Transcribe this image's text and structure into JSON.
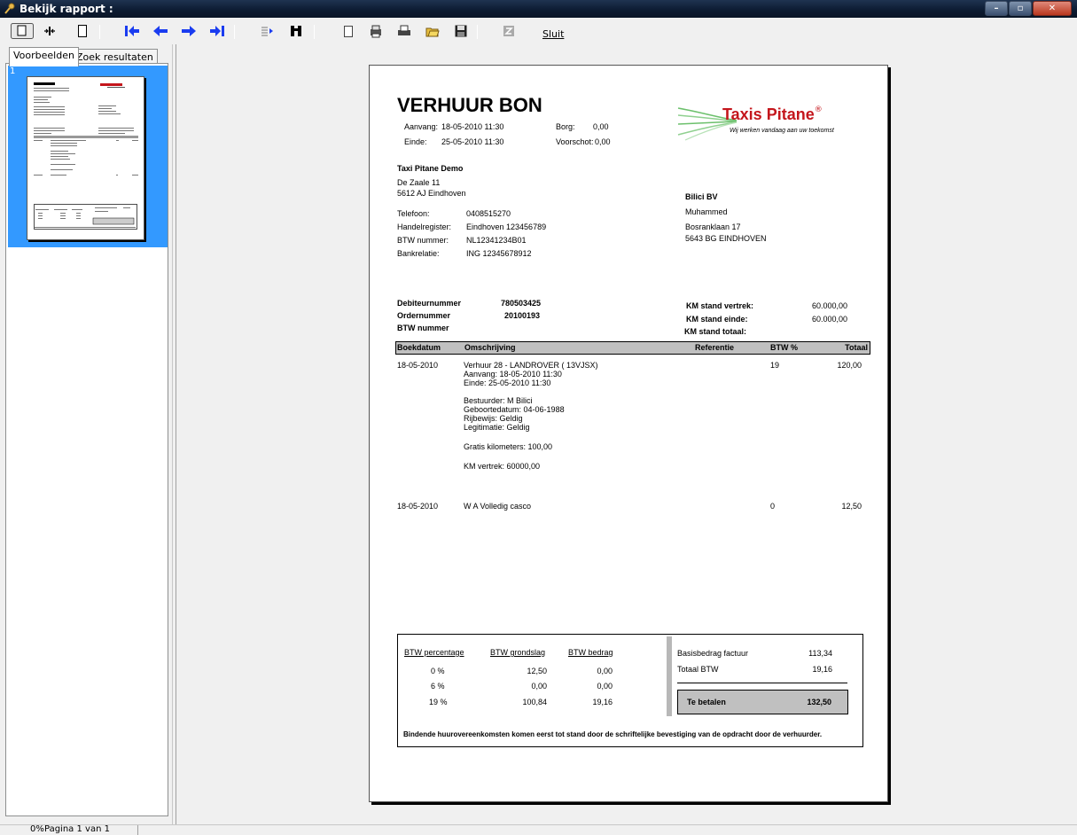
{
  "window": {
    "title": "Bekijk rapport :"
  },
  "toolbar": {
    "close_label": "Sluit",
    "icons": [
      "single-page-view-icon",
      "two-page-view-icon",
      "page-width-icon",
      "first-page-icon",
      "previous-page-icon",
      "next-page-icon",
      "last-page-icon",
      "goto-page-icon",
      "find-icon",
      "copy-icon",
      "print-setup-icon",
      "print-icon",
      "open-icon",
      "save-icon",
      "export-icon"
    ]
  },
  "tabs": [
    {
      "label": "Voorbeelden",
      "active": true
    },
    {
      "label": "Zoek resultaten",
      "active": false
    }
  ],
  "thumbnail": {
    "page_number": "1"
  },
  "document": {
    "title": "VERHUUR BON",
    "dates": {
      "aanvang_label": "Aanvang:",
      "aanvang_value": "18-05-2010 11:30",
      "einde_label": "Einde:",
      "einde_value": "25-05-2010 11:30",
      "borg_label": "Borg:",
      "borg_value": "0,00",
      "voorschot_label": "Voorschot:",
      "voorschot_value": "0,00"
    },
    "logo": {
      "name": "Taxis Pitane",
      "registered": "®",
      "tagline": "Wij werken vandaag aan uw toekomst"
    },
    "company": {
      "name": "Taxi Pitane Demo",
      "street": "De Zaale 11",
      "city": "5612 AJ Eindhoven",
      "telefoon_label": "Telefoon:",
      "telefoon": "0408515270",
      "handelsregister_label": "Handelregister:",
      "handelsregister": "Eindhoven 123456789",
      "btw_label": "BTW nummer:",
      "btw": "NL12341234B01",
      "bank_label": "Bankrelatie:",
      "bank": "ING 12345678912"
    },
    "customer": {
      "name": "Bilici BV",
      "contact": "Muhammed",
      "street": "Bosranklaan 17",
      "city": "5643 BG EINDHOVEN"
    },
    "refs": {
      "debiteur_label": "Debiteurnummer",
      "debiteur": "780503425",
      "order_label": "Ordernummer",
      "order": "20100193",
      "btw_label": "BTW nummer",
      "km_vertrek_label": "KM stand vertrek:",
      "km_vertrek": "60.000,00",
      "km_einde_label": "KM stand einde:",
      "km_einde": "60.000,00",
      "km_totaal_label": "KM stand totaal:"
    },
    "table_header": {
      "boekdatum": "Boekdatum",
      "omschrijving": "Omschrijving",
      "referentie": "Referentie",
      "btw": "BTW %",
      "totaal": "Totaal"
    },
    "lines": [
      {
        "date": "18-05-2010",
        "desc": [
          "Verhuur 28 - LANDROVER ( 13VJSX)",
          "Aanvang: 18-05-2010 11:30",
          "Einde: 25-05-2010 11:30",
          "",
          "Bestuurder: M  Bilici",
          "Geboortedatum: 04-06-1988",
          "Rijbewijs: Geldig",
          "Legitimatie: Geldig",
          "",
          "Gratis kilometers: 100,00",
          "",
          "KM vertrek: 60000,00"
        ],
        "btw": "19",
        "total": "120,00"
      },
      {
        "date": "18-05-2010",
        "desc": [
          "W A Volledig casco"
        ],
        "btw": "0",
        "total": "12,50"
      }
    ],
    "vat_table": {
      "headers": [
        "BTW percentage",
        "BTW grondslag",
        "BTW bedrag"
      ],
      "rows": [
        {
          "pct": "0 %",
          "base": "12,50",
          "amount": "0,00"
        },
        {
          "pct": "6 %",
          "base": "0,00",
          "amount": "0,00"
        },
        {
          "pct": "19 %",
          "base": "100,84",
          "amount": "19,16"
        }
      ]
    },
    "totals": {
      "basis_label": "Basisbedrag factuur",
      "basis": "113,34",
      "btw_label": "Totaal BTW",
      "btw": "19,16",
      "pay_label": "Te betalen",
      "pay": "132,50"
    },
    "footer_note": "Bindende huurovereenkomsten komen eerst tot stand door de schriftelijke bevestiging van de opdracht door de verhuurder."
  },
  "status": {
    "zoom": "0%",
    "page": "Pagina 1 van 1"
  }
}
